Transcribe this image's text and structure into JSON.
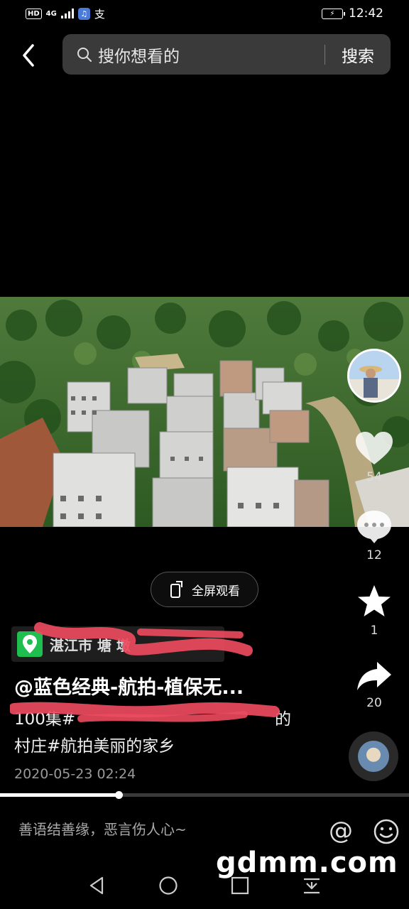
{
  "status_bar": {
    "hd": "HD",
    "network": "4G",
    "time": "12:42"
  },
  "search": {
    "placeholder": "搜你想看的",
    "button": "搜索"
  },
  "video": {
    "fullscreen_label": "全屏观看",
    "progress_percent": 29
  },
  "actions": {
    "likes": "54",
    "comments": "12",
    "favorites": "1",
    "shares": "20"
  },
  "post": {
    "location": "湛江市 塘 墩",
    "author": "@蓝色经典-航拍-植保无...",
    "description_line1": "100集#",
    "description_line1_end": "的",
    "description_line2": "村庄#航拍美丽的家乡",
    "date": "2020-05-23 02:24"
  },
  "comment_bar": {
    "placeholder": "善语结善缘，恶言伤人心~",
    "at_symbol": "@"
  },
  "watermark": "gdmm.com",
  "icons": [
    "back-arrow-icon",
    "search-icon",
    "heart-icon",
    "comment-icon",
    "star-icon",
    "share-icon",
    "location-pin-icon",
    "fullscreen-icon",
    "emoji-icon",
    "nav-back-icon",
    "nav-home-icon",
    "nav-recents-icon",
    "nav-menu-icon"
  ]
}
